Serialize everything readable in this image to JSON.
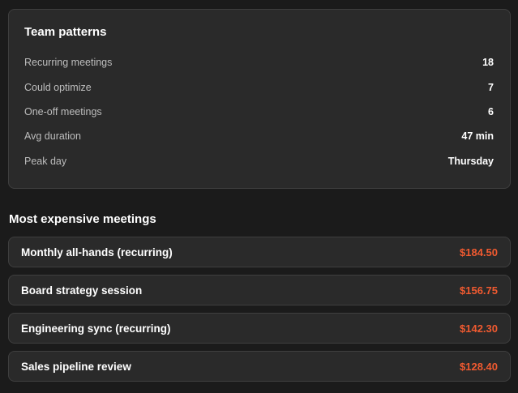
{
  "patterns": {
    "title": "Team patterns",
    "stats": [
      {
        "label": "Recurring meetings",
        "value": "18"
      },
      {
        "label": "Could optimize",
        "value": "7"
      },
      {
        "label": "One-off meetings",
        "value": "6"
      },
      {
        "label": "Avg duration",
        "value": "47 min"
      },
      {
        "label": "Peak day",
        "value": "Thursday"
      }
    ]
  },
  "expensive": {
    "title": "Most expensive meetings",
    "accent_color": "#f05a30",
    "items": [
      {
        "name": "Monthly all-hands (recurring)",
        "cost": "$184.50"
      },
      {
        "name": "Board strategy session",
        "cost": "$156.75"
      },
      {
        "name": "Engineering sync (recurring)",
        "cost": "$142.30"
      },
      {
        "name": "Sales pipeline review",
        "cost": "$128.40"
      }
    ]
  }
}
